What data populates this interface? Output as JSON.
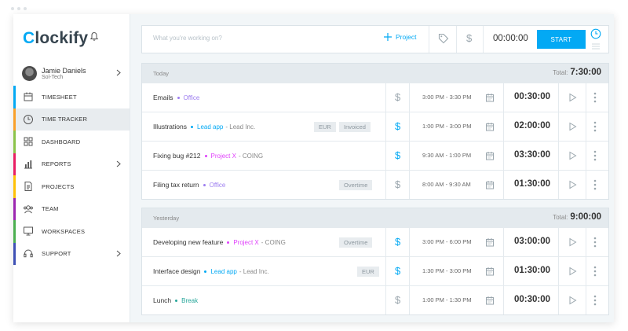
{
  "app": {
    "logo_text": "lockify",
    "logo_c": "C"
  },
  "user": {
    "name": "Jamie Daniels",
    "workspace": "Sol-Tech"
  },
  "nav": [
    {
      "label": "TIMESHEET",
      "color": "#03a9f4",
      "icon": "timesheet-icon",
      "chevron": false,
      "active": false
    },
    {
      "label": "TIME TRACKER",
      "color": "#f9a02a",
      "icon": "clock-icon",
      "chevron": false,
      "active": true
    },
    {
      "label": "DASHBOARD",
      "color": "#8bc34a",
      "icon": "dashboard-icon",
      "chevron": false,
      "active": false
    },
    {
      "label": "REPORTS",
      "color": "#e91e63",
      "icon": "reports-icon",
      "chevron": true,
      "active": false
    },
    {
      "label": "PROJECTS",
      "color": "#ffc107",
      "icon": "projects-icon",
      "chevron": false,
      "active": false
    },
    {
      "label": "TEAM",
      "color": "#9c27b0",
      "icon": "team-icon",
      "chevron": false,
      "active": false
    },
    {
      "label": "WORKSPACES",
      "color": "#4caf50",
      "icon": "workspaces-icon",
      "chevron": false,
      "active": false
    },
    {
      "label": "SUPPORT",
      "color": "#3f51b5",
      "icon": "support-icon",
      "chevron": true,
      "active": false
    }
  ],
  "timer": {
    "placeholder": "What you're working on?",
    "project_label": "Project",
    "time": "00:00:00",
    "start_label": "START"
  },
  "groups": [
    {
      "title": "Today",
      "total_label": "Total:",
      "total": "7:30:00",
      "entries": [
        {
          "desc": "Emails",
          "project": "Office",
          "project_color": "#9c7cf0",
          "client": "",
          "badges": [],
          "billable": false,
          "range": "3:00 PM - 3:30 PM",
          "duration": "00:30:00"
        },
        {
          "desc": "Illustrations",
          "project": "Lead app",
          "project_color": "#03a9f4",
          "client": "- Lead Inc.",
          "badges": [
            "EUR",
            "Invoiced"
          ],
          "billable": true,
          "range": "1:00 PM - 3:00 PM",
          "duration": "02:00:00"
        },
        {
          "desc": "Fixing bug #212",
          "project": "Project X",
          "project_color": "#e040fb",
          "client": "- COING",
          "badges": [],
          "billable": true,
          "range": "9:30 AM - 1:00 PM",
          "duration": "03:30:00"
        },
        {
          "desc": "Filing tax return",
          "project": "Office",
          "project_color": "#9c7cf0",
          "client": "",
          "badges": [
            "Overtime"
          ],
          "billable": false,
          "range": "8:00 AM - 9:30 AM",
          "duration": "01:30:00"
        }
      ]
    },
    {
      "title": "Yesterday",
      "total_label": "Total:",
      "total": "9:00:00",
      "entries": [
        {
          "desc": "Developing new feature",
          "project": "Project X",
          "project_color": "#e040fb",
          "client": "- COING",
          "badges": [
            "Overtime"
          ],
          "billable": true,
          "range": "3:00 PM - 6:00 PM",
          "duration": "03:00:00"
        },
        {
          "desc": "Interface design",
          "project": "Lead app",
          "project_color": "#03a9f4",
          "client": "- Lead Inc.",
          "badges": [
            "EUR"
          ],
          "billable": true,
          "range": "1:30 PM - 3:00 PM",
          "duration": "01:30:00"
        },
        {
          "desc": "Lunch",
          "project": "Break",
          "project_color": "#26a69a",
          "client": "",
          "badges": [],
          "billable": false,
          "range": "1:00 PM - 1:30 PM",
          "duration": "00:30:00"
        }
      ]
    }
  ],
  "colors": {
    "accent": "#03a9f4",
    "muted": "#9aa6ad"
  }
}
